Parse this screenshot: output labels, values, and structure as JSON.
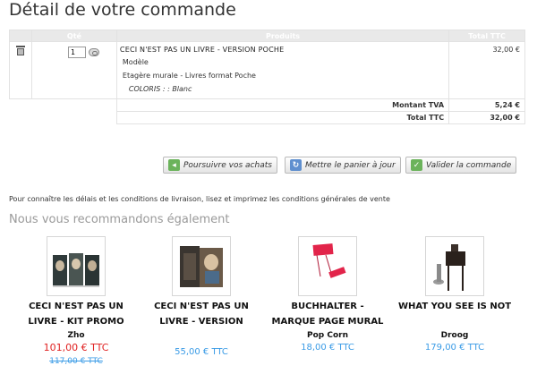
{
  "page": {
    "title": "Détail de votre commande"
  },
  "cart": {
    "headers": {
      "qty": "Qté",
      "product": "Produits",
      "total": "Total TTC"
    },
    "item": {
      "quantity": "1",
      "name": "CECI N'EST PAS UN LIVRE - VERSION POCHE",
      "model_label": "Modèle",
      "model_value": "Etagère murale - Livres format Poche",
      "attribute": "COLORIS : : Blanc",
      "total": "32,00 €"
    },
    "tva_label": "Montant TVA",
    "tva_value": "5,24 €",
    "total_label": "Total TTC",
    "total_value": "32,00 €"
  },
  "actions": {
    "continue": "Poursuivre vos achats",
    "update": "Mettre le panier à jour",
    "validate": "Valider la commande"
  },
  "notice": "Pour connaître les délais et les conditions de livraison, lisez et imprimez les conditions générales de vente",
  "recommendations": {
    "title": "Nous vous recommandons également",
    "items": [
      {
        "line1": "CECI N'EST PAS UN",
        "line2": "LIVRE - KIT PROMO",
        "brand": "Zho",
        "price": "101,00 € TTC",
        "old_price": "117,00 € TTC"
      },
      {
        "line1": "CECI N'EST PAS UN",
        "line2": "LIVRE - VERSION",
        "brand": "",
        "price": "55,00 € TTC"
      },
      {
        "line1": "BUCHHALTER -",
        "line2": "MARQUE PAGE MURAL",
        "brand": "Pop Corn",
        "price": "18,00 € TTC"
      },
      {
        "line1": "WHAT YOU SEE IS NOT",
        "line2": "",
        "brand": "Droog",
        "price": "179,00 € TTC"
      }
    ]
  }
}
